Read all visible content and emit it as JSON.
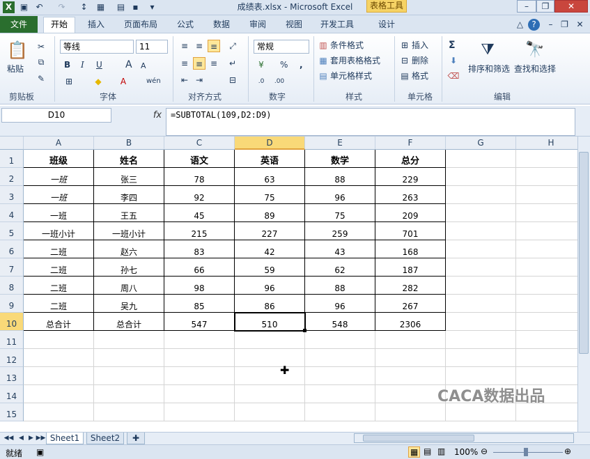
{
  "window": {
    "title": "成绩表.xlsx - Microsoft Excel",
    "context_tab": "表格工具"
  },
  "tabs": [
    "文件",
    "开始",
    "插入",
    "页面布局",
    "公式",
    "数据",
    "审阅",
    "视图",
    "开发工具",
    "设计"
  ],
  "ribbon": {
    "clipboard": {
      "paste": "粘贴",
      "label": "剪贴板"
    },
    "font": {
      "name": "等线",
      "size": "11",
      "bold": "B",
      "italic": "I",
      "underline": "U",
      "grow": "A",
      "shrink": "A",
      "label": "字体"
    },
    "alignment": {
      "label": "对齐方式"
    },
    "number": {
      "format": "常规",
      "percent": "%",
      "comma": ",",
      "label": "数字"
    },
    "styles": {
      "conditional": "条件格式",
      "table_format": "套用表格格式",
      "cell_styles": "单元格样式",
      "label": "样式"
    },
    "cells": {
      "insert": "插入",
      "delete": "删除",
      "format": "格式",
      "label": "单元格"
    },
    "editing": {
      "sigma": "Σ",
      "sort_filter": "排序和筛选",
      "find_select": "查找和选择",
      "label": "编辑"
    }
  },
  "formula_bar": {
    "name_box": "D10",
    "fx": "fx",
    "formula": "=SUBTOTAL(109,D2:D9)"
  },
  "columns": [
    "A",
    "B",
    "C",
    "D",
    "E",
    "F",
    "G",
    "H"
  ],
  "rows": [
    "1",
    "2",
    "3",
    "4",
    "5",
    "6",
    "7",
    "8",
    "9",
    "10",
    "11",
    "12",
    "13",
    "14",
    "15"
  ],
  "table": [
    [
      "班级",
      "姓名",
      "语文",
      "英语",
      "数学",
      "总分"
    ],
    [
      "一班",
      "张三",
      "78",
      "63",
      "88",
      "229"
    ],
    [
      "一班",
      "李四",
      "92",
      "75",
      "96",
      "263"
    ],
    [
      "一班",
      "王五",
      "45",
      "89",
      "75",
      "209"
    ],
    [
      "一班小计",
      "一班小计",
      "215",
      "227",
      "259",
      "701"
    ],
    [
      "二班",
      "赵六",
      "83",
      "42",
      "43",
      "168"
    ],
    [
      "二班",
      "孙七",
      "66",
      "59",
      "62",
      "187"
    ],
    [
      "二班",
      "周八",
      "98",
      "96",
      "88",
      "282"
    ],
    [
      "二班",
      "吴九",
      "85",
      "86",
      "96",
      "267"
    ],
    [
      "总合计",
      "总合计",
      "547",
      "510",
      "548",
      "2306"
    ]
  ],
  "selected": {
    "col": "D",
    "row": "10"
  },
  "sheets": [
    "Sheet1",
    "Sheet2"
  ],
  "status": {
    "ready": "就绪",
    "zoom": "100%"
  },
  "watermark": "CACA数据出品",
  "colors": {
    "file_tab": "#2a6e2e",
    "selection_header": "#f9d978",
    "ribbon_bg": "#dbe5f1"
  }
}
